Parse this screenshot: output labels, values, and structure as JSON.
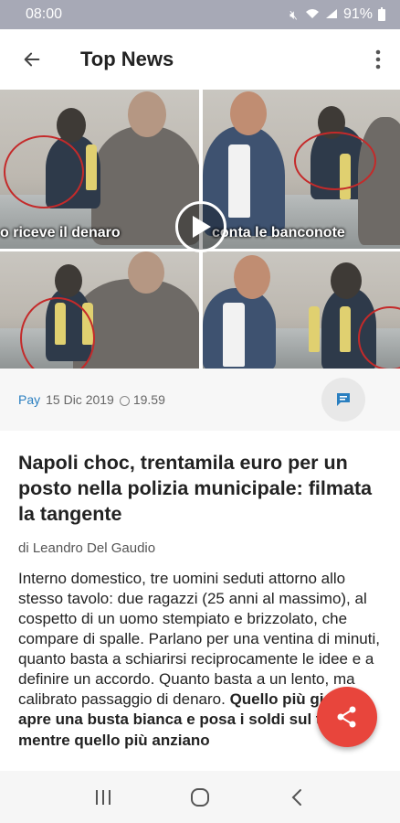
{
  "status_bar": {
    "time": "08:00",
    "battery": "91%",
    "icons": [
      "mute-icon",
      "wifi-icon",
      "signal-icon",
      "battery-icon"
    ]
  },
  "app_bar": {
    "title": "Top News",
    "icons": [
      "back-arrow-icon",
      "more-vert-icon"
    ]
  },
  "hero": {
    "captions": [
      "o riceve il denaro",
      "conta le banconote"
    ],
    "icons": [
      "play-icon"
    ]
  },
  "meta": {
    "source": "Pay",
    "date": "15 Dic 2019",
    "time": "19.59",
    "icons": [
      "clock-icon",
      "comment-icon"
    ]
  },
  "article": {
    "headline": "Napoli choc, trentamila euro per un posto nella polizia municipale: filmata la tangente",
    "byline": "di Leandro Del Gaudio",
    "body": "Interno domestico, tre uomini seduti attorno allo stesso tavolo: due ragazzi (25 anni al massimo), al cospetto di un uomo stempiato e brizzolato, che compare di spalle. Parlano per una ventina di minuti, quanto basta a schiarirsi reciprocamente le idee e a definire un accordo. Quanto basta a un lento, ma calibrato passaggio di denaro.",
    "body_bold": "Quello più giovane apre una busta bianca e posa i soldi sul tavolo: mentre quello più anziano"
  },
  "fab": {
    "icon": "share-icon"
  },
  "nav_bar": {
    "icons": [
      "recent-apps-icon",
      "home-icon",
      "back-icon"
    ]
  },
  "colors": {
    "accent": "#e8453c",
    "link": "#2a7fc0",
    "status_bar": "#a7a9b6"
  }
}
